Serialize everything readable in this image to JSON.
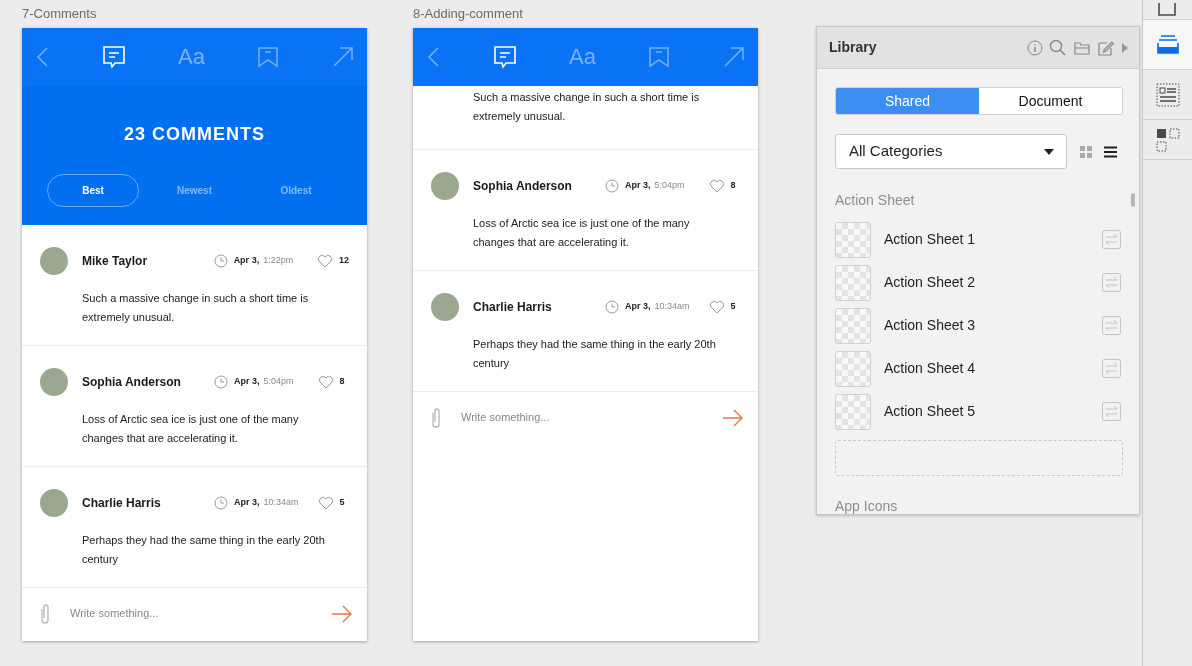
{
  "artboards": [
    {
      "label": "7-Comments",
      "nav": [
        {
          "kind": "back",
          "selected": false
        },
        {
          "kind": "comments",
          "selected": true
        },
        {
          "kind": "font",
          "label": "Aa",
          "selected": false
        },
        {
          "kind": "bookmark",
          "selected": false
        },
        {
          "kind": "share",
          "selected": false
        }
      ],
      "header": {
        "title": "23 COMMENTS",
        "filters": [
          {
            "label": "Best",
            "selected": true
          },
          {
            "label": "Newest",
            "selected": false
          },
          {
            "label": "Oldest",
            "selected": false
          }
        ]
      },
      "comments": [
        {
          "name": "Mike Taylor",
          "date": "Apr 3,",
          "time": "1:22pm",
          "likes": "12",
          "text": "Such a massive change in such a short time is extremely unusual."
        },
        {
          "name": "Sophia Anderson",
          "date": "Apr 3,",
          "time": "5:04pm",
          "likes": "8",
          "text": "Loss of Arctic sea ice is just one of the many changes that are accelerating it."
        },
        {
          "name": "Charlie Harris",
          "date": "Apr 3,",
          "time": "10:34am",
          "likes": "5",
          "text": "Perhaps they had the same thing in the early 20th century"
        }
      ],
      "composer": {
        "placeholder": "Write something..."
      }
    },
    {
      "label": "8-Adding-comment",
      "nav": [
        {
          "kind": "back",
          "selected": false
        },
        {
          "kind": "comments",
          "selected": true
        },
        {
          "kind": "font",
          "label": "Aa",
          "selected": false
        },
        {
          "kind": "bookmark",
          "selected": false
        },
        {
          "kind": "share",
          "selected": false
        }
      ],
      "comments": [
        {
          "text": "Such a massive change in such a short time is extremely unusual."
        },
        {
          "name": "Sophia Anderson",
          "date": "Apr 3,",
          "time": "5:04pm",
          "likes": "8",
          "text": "Loss of Arctic sea ice is just one of the many changes that are accelerating it."
        },
        {
          "name": "Charlie Harris",
          "date": "Apr 3,",
          "time": "10:34am",
          "likes": "5",
          "text": "Perhaps they had the same thing in the early 20th century"
        }
      ],
      "composer": {
        "placeholder": "Write something..."
      }
    }
  ],
  "library": {
    "title": "Library",
    "segments": [
      {
        "label": "Shared",
        "selected": true
      },
      {
        "label": "Document",
        "selected": false
      }
    ],
    "category": {
      "value": "All Categories"
    },
    "view_modes": [
      {
        "kind": "grid",
        "selected": false
      },
      {
        "kind": "list",
        "selected": true
      }
    ],
    "sections": [
      {
        "title": "Action Sheet",
        "items": [
          {
            "label": "Action Sheet 1"
          },
          {
            "label": "Action Sheet 2"
          },
          {
            "label": "Action Sheet 3"
          },
          {
            "label": "Action Sheet 4"
          },
          {
            "label": "Action Sheet 5"
          }
        ]
      },
      {
        "title": "App Icons"
      }
    ]
  },
  "toolbar": [
    {
      "kind": "export",
      "selected": false
    },
    {
      "kind": "library",
      "selected": true
    },
    {
      "kind": "properties",
      "selected": false
    },
    {
      "kind": "components",
      "selected": false
    }
  ]
}
